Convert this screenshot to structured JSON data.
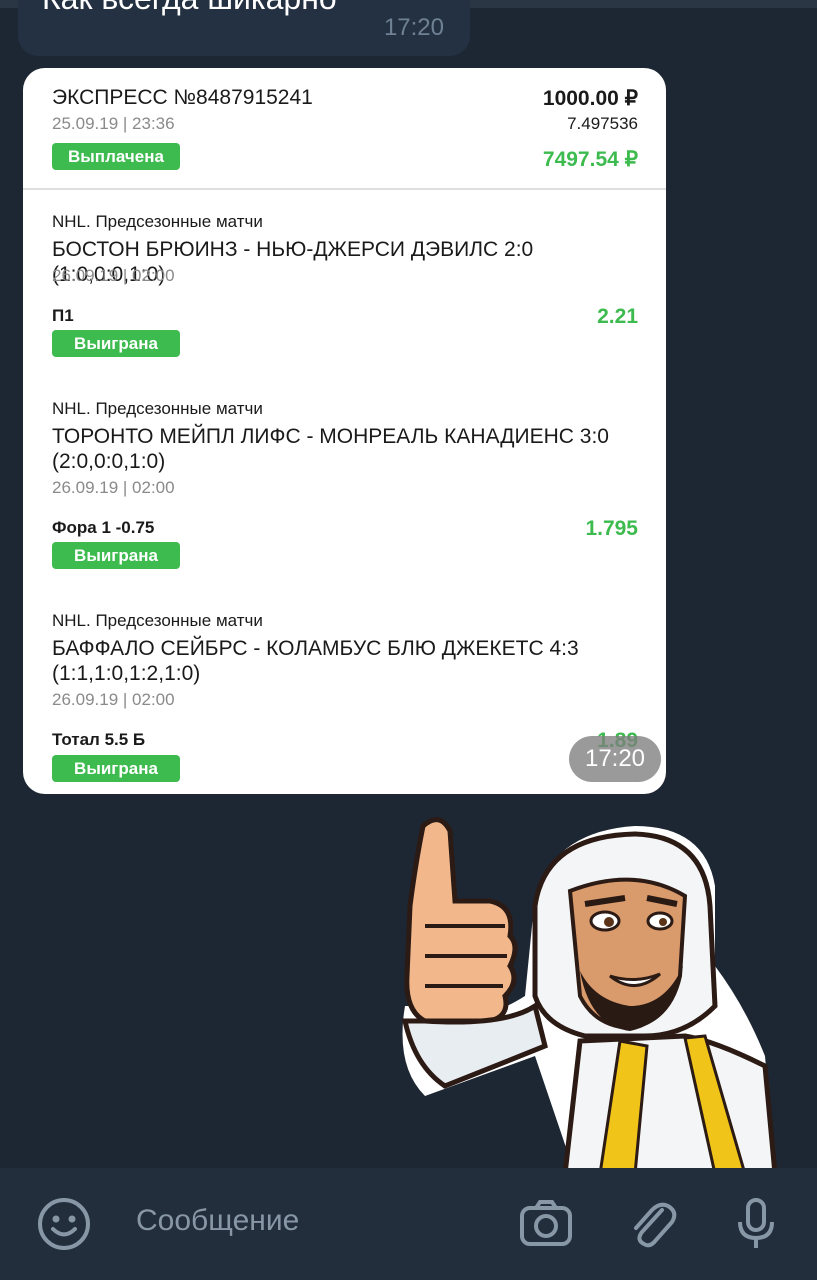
{
  "chat": {
    "previous_message": {
      "text": "Как всегда шикарно",
      "time": "17:20"
    }
  },
  "bet_card": {
    "header": {
      "title": "ЭКСПРЕСС №8487915241",
      "date": "25.09.19 | 23:36",
      "status": "Выплачена",
      "stake": "1000.00 ₽",
      "total_coef": "7.497536",
      "payout": "7497.54 ₽"
    },
    "events": [
      {
        "league": "NHL. Предсезонные матчи",
        "title": "БОСТОН БРЮИНЗ - НЬЮ-ДЖЕРСИ ДЭВИЛС 2:0 (1:0,0:0,1:0)",
        "date": "26.09.19 | 02:00",
        "bet": "П1",
        "odds": "2.21",
        "status": "Выиграна"
      },
      {
        "league": "NHL. Предсезонные матчи",
        "title": "ТОРОНТО МЕЙПЛ ЛИФС - МОНРЕАЛЬ КАНАДИЕНС 3:0 (2:0,0:0,1:0)",
        "date": "26.09.19 | 02:00",
        "bet": "Фора 1 -0.75",
        "odds": "1.795",
        "status": "Выиграна"
      },
      {
        "league": "NHL. Предсезонные матчи",
        "title": "БАФФАЛО СЕЙБРС - КОЛАМБУС БЛЮ ДЖЕКЕТС 4:3 (1:1,1:0,1:2,1:0)",
        "date": "26.09.19 | 02:00",
        "bet": "Тотал 5.5 Б",
        "odds": "1.89",
        "status": "Выиграна"
      }
    ],
    "time": "17:20"
  },
  "sticker": {
    "icon": "thumbs-up-sheikh-sticker"
  },
  "composer": {
    "placeholder": "Сообщение",
    "icons": [
      "emoji-icon",
      "camera-icon",
      "paperclip-icon",
      "microphone-icon"
    ]
  },
  "colors": {
    "background": "#1d2733",
    "bubble_dark": "#243142",
    "card": "#ffffff",
    "accent_green": "#3dbb4f",
    "composer": "#232e3c"
  }
}
